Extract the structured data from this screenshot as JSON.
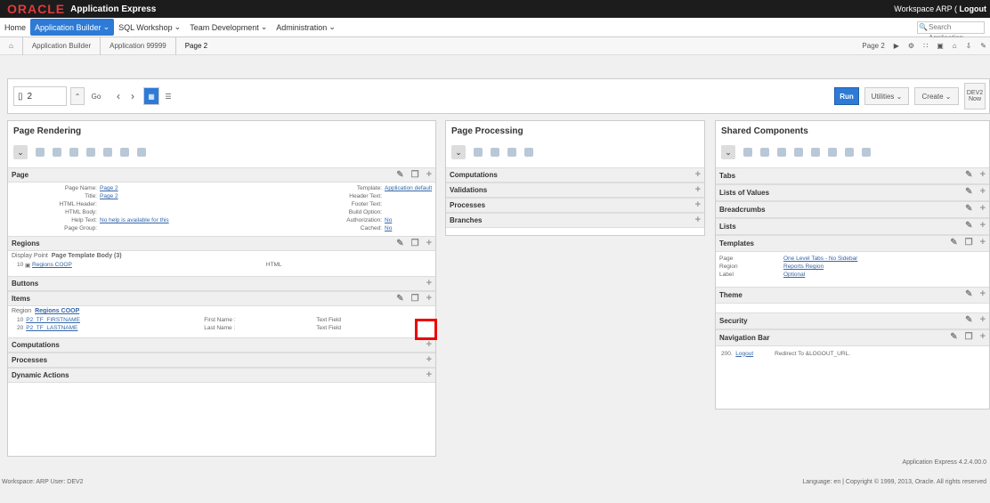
{
  "brand": {
    "logo": "ORACLE",
    "app_title": "Application Express"
  },
  "workspace": {
    "label": "Workspace ARP",
    "logout": "Logout"
  },
  "nav": [
    "Home",
    "Application Builder",
    "SQL Workshop",
    "Team Development",
    "Administration"
  ],
  "search": {
    "placeholder": "Search Application"
  },
  "breadcrumb": [
    "Application Builder",
    "Application 99999",
    "Page 2"
  ],
  "crumb_right": {
    "page": "Page 2"
  },
  "toolbar": {
    "page_value": "2",
    "go": "Go",
    "run": "Run",
    "utilities": "Utilities",
    "create": "Create",
    "user_line1": "DEV2",
    "user_line2": "Now"
  },
  "rendering": {
    "title": "Page Rendering",
    "page_section": "Page",
    "page_left": [
      [
        "Page Name:",
        "Page 2"
      ],
      [
        "Title:",
        "Page 2"
      ],
      [
        "HTML Header:",
        ""
      ],
      [
        "HTML Body:",
        ""
      ],
      [
        "Help Text:",
        "No help is available for this"
      ],
      [
        "Page Group:",
        ""
      ]
    ],
    "page_right": [
      [
        "Template:",
        "Application default"
      ],
      [
        "Header Text:",
        ""
      ],
      [
        "Footer Text:",
        ""
      ],
      [
        "Build Option:",
        ""
      ],
      [
        "Authorization:",
        "No"
      ],
      [
        "Cached:",
        "No"
      ]
    ],
    "regions": "Regions",
    "display_point_label": "Display Point",
    "display_point": "Page Template Body (3)",
    "region_row": {
      "seq": "10",
      "name": "Regions COOP",
      "type": "HTML"
    },
    "buttons": "Buttons",
    "items": "Items",
    "region_label": "Region",
    "region_name": "Regions COOP",
    "item_rows": [
      [
        "10",
        "P2_TF_FIRSTNAME",
        "First Name :",
        "Text Field"
      ],
      [
        "20",
        "P2_TF_LASTNAME",
        "Last Name :",
        "Text Field"
      ]
    ],
    "computations": "Computations",
    "processes": "Processes",
    "dynamic_actions": "Dynamic Actions"
  },
  "processing": {
    "title": "Page Processing",
    "rows": [
      "Computations",
      "Validations",
      "Processes",
      "Branches"
    ]
  },
  "shared": {
    "title": "Shared Components",
    "tabs": "Tabs",
    "lov": "Lists of Values",
    "breadcrumbs": "Breadcrumbs",
    "lists": "Lists",
    "templates": "Templates",
    "template_rows": [
      [
        "Page",
        "One Level Tabs - No Sidebar"
      ],
      [
        "Region",
        "Reports Region"
      ],
      [
        "Label",
        "Optional"
      ]
    ],
    "theme": "Theme",
    "security": "Security",
    "navbar": "Navigation Bar",
    "nav_row": {
      "seq": "200.",
      "name": "Logout",
      "target": "Redirect To &LOGOUT_URL."
    }
  },
  "footer": {
    "left": "Workspace: ARP User: DEV2",
    "version": "Application Express 4.2.4.00.0",
    "copyright": "Language: en | Copyright © 1999, 2013, Oracle. All rights reserved"
  },
  "colors": {
    "accent": "#2d7bd6",
    "highlight": "#e00000",
    "topbar": "#1c1c1c"
  }
}
